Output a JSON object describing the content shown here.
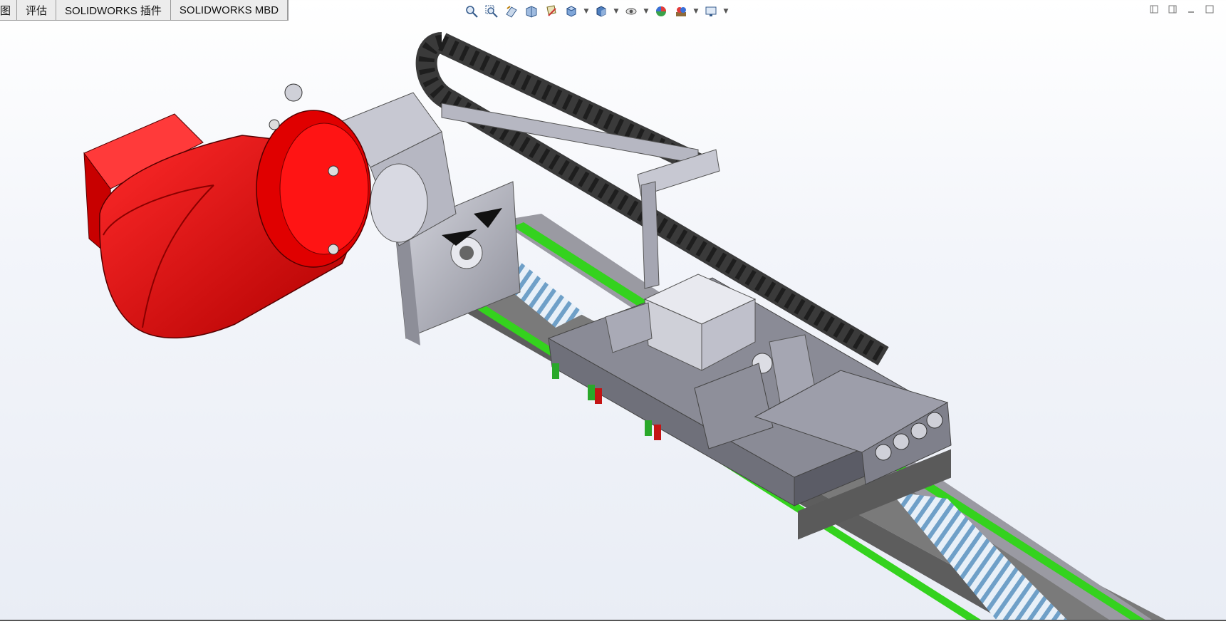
{
  "tabs": [
    {
      "label": "图"
    },
    {
      "label": "评估"
    },
    {
      "label": "SOLIDWORKS 插件"
    },
    {
      "label": "SOLIDWORKS MBD"
    }
  ],
  "heads_up_toolbar": [
    {
      "icon": "zoom-to-fit-icon"
    },
    {
      "icon": "zoom-to-area-icon"
    },
    {
      "icon": "previous-view-icon"
    },
    {
      "icon": "section-view-icon"
    },
    {
      "icon": "dynamic-annotation-views-icon"
    },
    {
      "icon": "view-orientation-icon",
      "dropdown": true
    },
    {
      "icon": "display-style-icon",
      "dropdown": true
    },
    {
      "icon": "hide-show-items-icon",
      "dropdown": true
    },
    {
      "icon": "edit-appearance-icon"
    },
    {
      "icon": "apply-scene-icon",
      "dropdown": true
    },
    {
      "icon": "view-settings-icon",
      "dropdown": true
    }
  ],
  "window_controls": [
    {
      "icon": "collapse-left-icon"
    },
    {
      "icon": "collapse-right-icon"
    },
    {
      "icon": "minimize-icon"
    },
    {
      "icon": "close-icon"
    }
  ],
  "colors": {
    "motor": "#e00000",
    "rail_stripe": "#34d21e",
    "metal": "#b9bac4",
    "base_dark": "#6e6e6e",
    "chain": "#3a3a3a"
  }
}
